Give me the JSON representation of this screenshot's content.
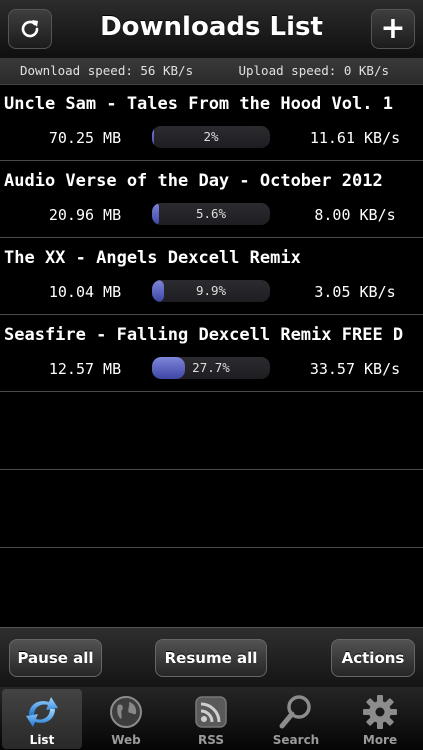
{
  "header": {
    "title": "Downloads List",
    "refresh_icon": "refresh-icon",
    "add_label": "+"
  },
  "speeds": {
    "download": "Download speed: 56 KB/s",
    "upload": "Upload speed: 0 KB/s"
  },
  "downloads": [
    {
      "name": "Uncle Sam - Tales From the Hood Vol. 1",
      "size": "70.25 MB",
      "progress_label": "2%",
      "progress": 0.02,
      "speed": "11.61 KB/s"
    },
    {
      "name": "Audio Verse of the Day - October 2012",
      "size": "20.96 MB",
      "progress_label": "5.6%",
      "progress": 0.056,
      "speed": "8.00 KB/s"
    },
    {
      "name": "The XX - Angels Dexcell Remix",
      "size": "10.04 MB",
      "progress_label": "9.9%",
      "progress": 0.099,
      "speed": "3.05 KB/s"
    },
    {
      "name": "Seasfire - Falling Dexcell Remix FREE D",
      "size": "12.57 MB",
      "progress_label": "27.7%",
      "progress": 0.277,
      "speed": "33.57 KB/s"
    }
  ],
  "actions": {
    "pause_all": "Pause all",
    "resume_all": "Resume all",
    "actions": "Actions"
  },
  "tabs": [
    {
      "label": "List",
      "icon": "list-sync-icon",
      "active": true
    },
    {
      "label": "Web",
      "icon": "globe-icon",
      "active": false
    },
    {
      "label": "RSS",
      "icon": "rss-icon",
      "active": false
    },
    {
      "label": "Search",
      "icon": "magnifier-icon",
      "active": false
    },
    {
      "label": "More",
      "icon": "gear-icon",
      "active": false
    }
  ],
  "colors": {
    "progress_fill": "#5a63c4",
    "background": "#000000"
  }
}
